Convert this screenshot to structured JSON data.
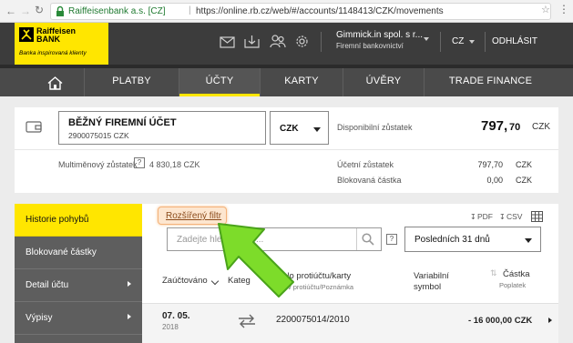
{
  "browser": {
    "site_name": "Raiffeisenbank a.s. [CZ]",
    "url": "https://online.rb.cz/web/#/accounts/1148413/CZK/movements"
  },
  "header": {
    "logo_line1": "Raiffeisen",
    "logo_line2": "BANK",
    "logo_tagline": "Banka inspirovaná klienty",
    "company": "Gimmick.in spol. s r...",
    "company_sub": "Firemní bankovnictví",
    "language": "CZ",
    "logout": "ODHLÁSIT"
  },
  "nav": {
    "items": [
      {
        "label": "PLATBY"
      },
      {
        "label": "ÚČTY"
      },
      {
        "label": "KARTY"
      },
      {
        "label": "ÚVĚRY"
      },
      {
        "label": "TRADE FINANCE"
      }
    ]
  },
  "account": {
    "name": "BĚŽNÝ FIREMNÍ ÚČET",
    "number": "2900075015 CZK",
    "currency": "CZK",
    "available_label": "Disponibilní zůstatek",
    "available_int": "797,",
    "available_dec": "70",
    "available_cur": "CZK",
    "multi_label": "Multiměnový zůstatek",
    "multi_value": "4 830,18 CZK",
    "book_label": "Účetní zůstatek",
    "book_value": "797,70",
    "book_cur": "CZK",
    "blocked_label": "Blokovaná částka",
    "blocked_value": "0,00",
    "blocked_cur": "CZK"
  },
  "sidebar": {
    "items": [
      {
        "label": "Historie pohybů"
      },
      {
        "label": "Blokované částky"
      },
      {
        "label": "Detail účtu"
      },
      {
        "label": "Výpisy"
      }
    ]
  },
  "filters": {
    "advanced": "Rozšířený filtr",
    "pdf": "PDF",
    "csv": "CSV",
    "search_placeholder": "Zadejte hle",
    "search_tail": "...",
    "period": "Posledních 31 dnů"
  },
  "table": {
    "col_date": "Zaúčtováno",
    "col_category": "Kateg",
    "col_counter_top": "íslo protiúčtu/karty",
    "col_counter_sub": "zev protiúčtu/Poznámka",
    "col_variable_1": "Variabilní",
    "col_variable_2": "symbol",
    "col_amount": "Částka",
    "col_fee": "Poplatek",
    "rows": [
      {
        "date": "07. 05.",
        "year": "2018",
        "counterparty": "2200075014/2010",
        "amount": "- 16 000,00 CZK"
      }
    ]
  }
}
